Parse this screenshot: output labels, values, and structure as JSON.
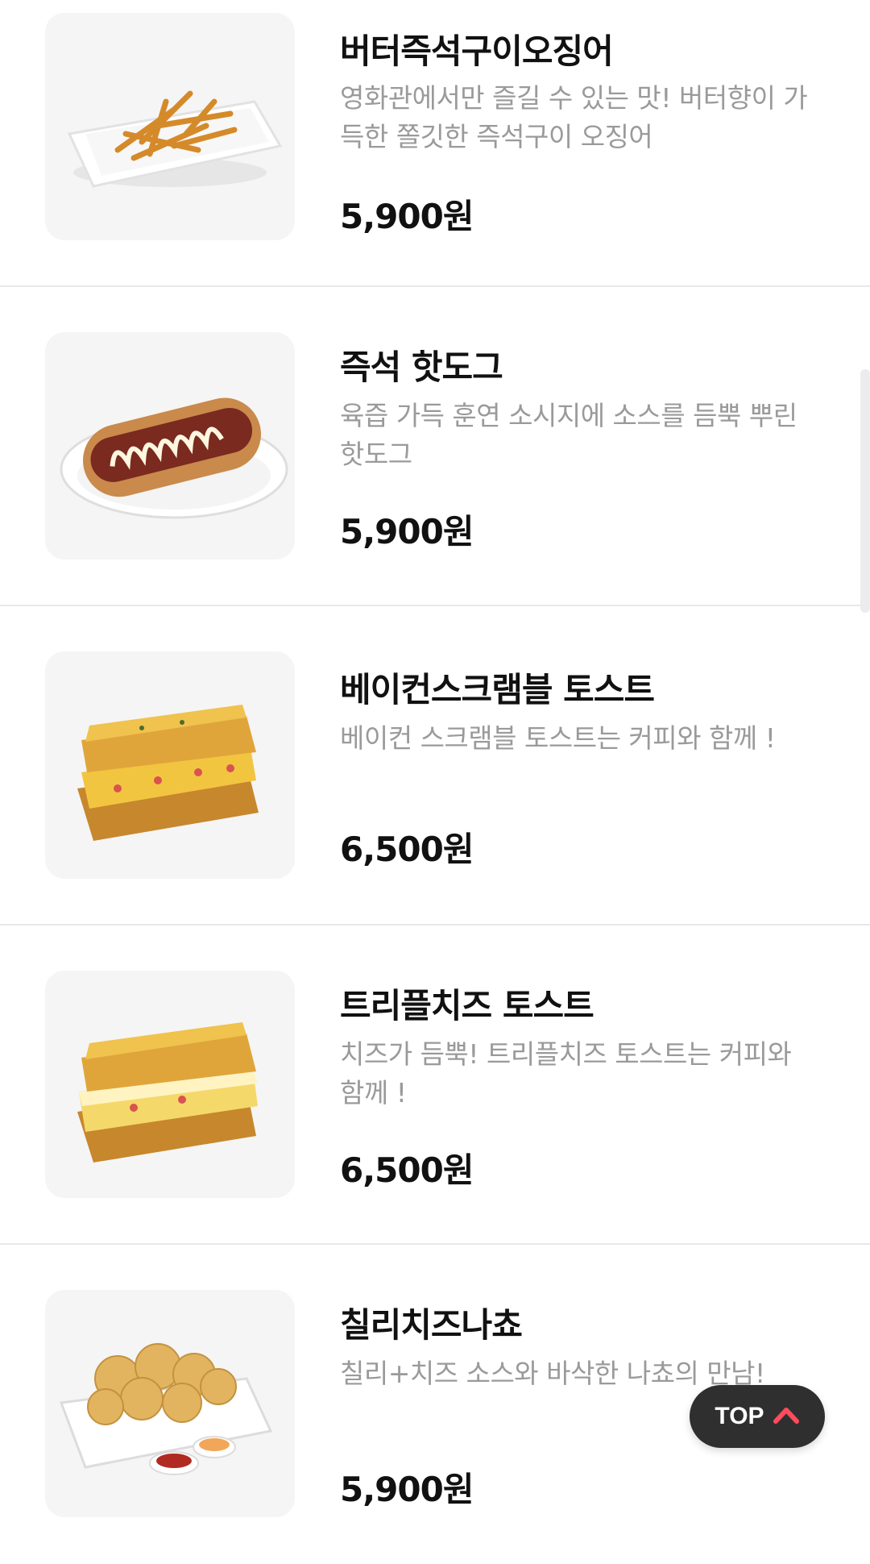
{
  "menu": [
    {
      "name": "버터즉석구이오징어",
      "description": "영화관에서만 즐길 수 있는 맛! 버터향이 가득한 쫄깃한 즉석구이 오징어",
      "price": "5,900원",
      "image_icon": "grilled-squid-plate-icon"
    },
    {
      "name": "즉석 핫도그",
      "description": "육즙 가득 훈연 소시지에 소스를 듬뿍 뿌린 핫도그",
      "price": "5,900원",
      "image_icon": "hotdog-plate-icon"
    },
    {
      "name": "베이컨스크램블 토스트",
      "description": "베이컨 스크램블 토스트는 커피와 함께 !",
      "price": "6,500원",
      "image_icon": "bacon-scramble-toast-icon"
    },
    {
      "name": "트리플치즈 토스트",
      "description": "치즈가 듬뿍! 트리플치즈 토스트는 커피와 함께 !",
      "price": "6,500원",
      "image_icon": "triple-cheese-toast-icon"
    },
    {
      "name": "칠리치즈나쵸",
      "description": "칠리+치즈 소스와 바삭한 나쵸의 만남!",
      "price": "5,900원",
      "image_icon": "chili-cheese-nachos-icon"
    }
  ],
  "top_button": {
    "label": "TOP",
    "icon": "chevron-up-icon",
    "accent": "#ff4b5c"
  }
}
